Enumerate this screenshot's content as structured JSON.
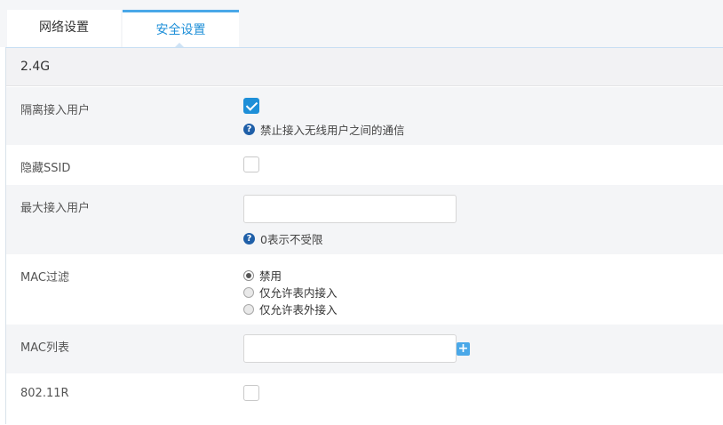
{
  "tabs": {
    "network_label": "网络设置",
    "security_label": "安全设置"
  },
  "section": {
    "title": "2.4G"
  },
  "rows": {
    "isolate": {
      "label": "隔离接入用户",
      "checked": true,
      "help": "禁止接入无线用户之间的通信"
    },
    "hide_ssid": {
      "label": "隐藏SSID",
      "checked": false
    },
    "max_clients": {
      "label": "最大接入用户",
      "value": "",
      "help": "0表示不受限"
    },
    "mac_filter": {
      "label": "MAC过滤",
      "options": [
        "禁用",
        "仅允许表内接入",
        "仅允许表外接入"
      ],
      "selected": 0
    },
    "mac_list": {
      "label": "MAC列表",
      "value": "",
      "add_symbol": "+"
    },
    "r80211": {
      "label": "802.11R",
      "checked": false
    }
  },
  "icons": {
    "help_symbol": "?"
  },
  "colors": {
    "accent": "#1e8fd8",
    "help_icon": "#1f5fa8",
    "row_gray": "#f4f5f7"
  }
}
